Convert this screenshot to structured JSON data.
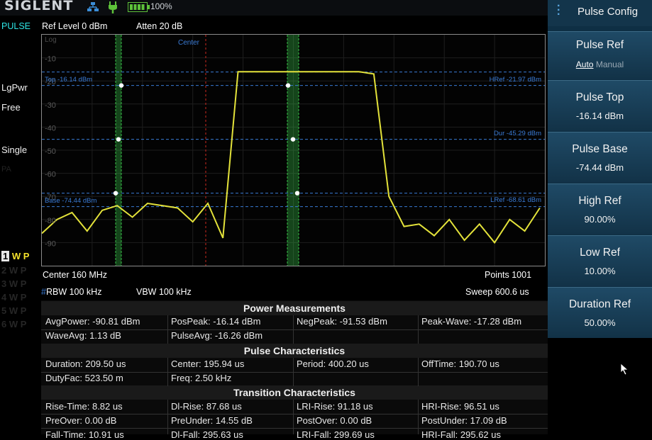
{
  "header": {
    "brand": "SIGLENT",
    "battery": "100%"
  },
  "info_row": {
    "mode": "PULSE",
    "ref_level": "Ref Level  0 dBm",
    "atten": "Atten  20 dB"
  },
  "left_status": {
    "detector": "LgPwr",
    "run": "Free",
    "sweep_mode": "Single",
    "pa": "PA",
    "traces": [
      {
        "num": "1",
        "w": "W",
        "p": "P"
      },
      {
        "num": "2",
        "w": "W",
        "p": "P"
      },
      {
        "num": "3",
        "w": "W",
        "p": "P"
      },
      {
        "num": "4",
        "w": "W",
        "p": "P"
      },
      {
        "num": "5",
        "w": "W",
        "p": "P"
      },
      {
        "num": "6",
        "w": "W",
        "p": "P"
      }
    ]
  },
  "plot": {
    "scale": "Log",
    "center_marker": "Center",
    "ylabels": [
      "-10",
      "-20",
      "-30",
      "-40",
      "-50",
      "-60",
      "-70",
      "-80",
      "-90"
    ],
    "ref_lines": {
      "top": "Top -16.14 dBm",
      "base": "Base -74.44 dBm",
      "href": "HRef -21.97 dBm",
      "dur": "Dur -45.29 dBm",
      "lref": "LRef -68.61 dBm"
    }
  },
  "bottom_info": {
    "center": "Center  160 MHz",
    "points": "Points  1001",
    "rbw": "RBW  100 kHz",
    "vbw": "VBW  100 kHz",
    "sweep": "Sweep  600.6 us"
  },
  "measurements": {
    "power_title": "Power Measurements",
    "power": [
      [
        "AvgPower: -90.81 dBm",
        "PosPeak: -16.14 dBm",
        "NegPeak: -91.53 dBm",
        "Peak-Wave: -17.28 dBm"
      ],
      [
        "WaveAvg: 1.13 dB",
        "PulseAvg: -16.26 dBm",
        "",
        ""
      ]
    ],
    "pulse_title": "Pulse Characteristics",
    "pulse": [
      [
        "Duration: 209.50 us",
        "Center: 195.94 us",
        "Period: 400.20 us",
        "OffTime: 190.70 us"
      ],
      [
        "DutyFac: 523.50 m",
        "Freq: 2.50 kHz",
        "",
        ""
      ]
    ],
    "transition_title": "Transition Characteristics",
    "transition": [
      [
        "Rise-Time: 8.82 us",
        "Dl-Rise: 87.68 us",
        "LRI-Rise: 91.18 us",
        "HRI-Rise: 96.51 us"
      ],
      [
        "PreOver: 0.00 dB",
        "PreUnder: 14.55 dB",
        "PostOver: 0.00 dB",
        "PostUnder: 17.09 dB"
      ],
      [
        "Fall-Time: 10.91 us",
        "Dl-Fall: 295.63 us",
        "LRI-Fall: 299.69 us",
        "HRI-Fall: 295.62 us"
      ]
    ]
  },
  "panel": {
    "title": "Pulse Config",
    "buttons": [
      {
        "label": "Pulse Ref",
        "opt_on": "Auto",
        "opt_off": "Manual"
      },
      {
        "label": "Pulse Top",
        "value": "-16.14 dBm"
      },
      {
        "label": "Pulse Base",
        "value": "-74.44 dBm"
      },
      {
        "label": "High Ref",
        "value": "90.00%"
      },
      {
        "label": "Low Ref",
        "value": "10.00%"
      },
      {
        "label": "Duration Ref",
        "value": "50.00%"
      }
    ]
  },
  "colors": {
    "trace": "#e3e23a",
    "ref_line": "#3a7bd5",
    "marker_green": "#39c24a",
    "center_line": "#cc2a1f",
    "mode": "#2ee6e6"
  },
  "chart_data": {
    "type": "line",
    "ylabel": "",
    "ylim": [
      -100,
      0
    ],
    "series": [
      {
        "x": [
          0,
          0.3,
          0.6,
          0.9,
          1.2,
          1.5,
          1.8,
          2.1,
          2.4,
          2.7,
          3.0,
          3.3,
          3.6,
          3.9,
          4.2,
          4.5,
          4.8,
          5.1,
          5.4,
          5.7,
          6.0,
          6.3,
          6.6,
          6.9,
          7.2,
          7.5,
          7.8,
          8.1,
          8.4,
          8.7,
          9.0,
          9.3,
          9.6,
          9.9
        ],
        "values": [
          -86,
          -80,
          -77,
          -85,
          -76,
          -74,
          -79,
          -73,
          -74,
          -75,
          -81,
          -73,
          -88,
          -16,
          -16,
          -16,
          -16,
          -16,
          -16,
          -16,
          -16,
          -16,
          -17,
          -70,
          -83,
          -82,
          -87,
          -80,
          -89,
          -82,
          -90,
          -80,
          -85,
          -75
        ]
      }
    ]
  }
}
